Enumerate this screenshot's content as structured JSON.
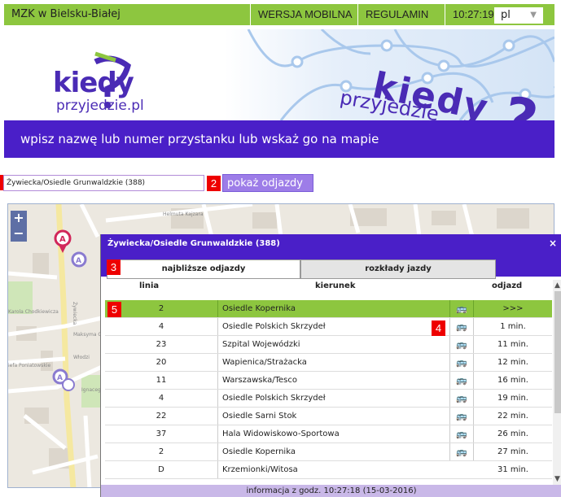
{
  "topbar": {
    "city": "MZK w Bielsku-Białej",
    "mobile_label": "WERSJA MOBILNA",
    "rules_label": "REGULAMIN",
    "time": "10:27:19",
    "lang": "pl"
  },
  "header": {
    "logo_main": "kiedy",
    "logo_sub": "przyjedzie",
    "logo_domain": ".pl",
    "graphic_kiedy": "kiedy",
    "graphic_przy": "przyjedzie",
    "graphic_q": "?"
  },
  "banner": {
    "text": "wpisz nazwę lub numer przystanku lub wskaż go na mapie"
  },
  "search": {
    "badge1": "1",
    "value": "Żywiecka/Osiedle Grunwaldzkie (388)",
    "badge2": "2",
    "show_label": "pokaż odjazdy"
  },
  "map": {
    "zoom_in": "+",
    "zoom_out": "−",
    "streets": [
      "Helmuta Kajzara",
      "Żywiecka",
      "Karola Chodkiewicza",
      "Maksyma G",
      "Włodzi",
      "Ignacego",
      "Grunwaldzka",
      "Ludwika",
      "Pozna"
    ]
  },
  "panel": {
    "title": "Żywiecka/Osiedle Grunwaldzkie (388)",
    "close": "×",
    "badge3": "3",
    "tab_active": "najbliższe odjazdy",
    "tab_inactive": "rozkłady jazdy",
    "col_line": "linia",
    "col_direction": "kierunek",
    "col_departure": "odjazd",
    "badge4": "4",
    "badge5": "5",
    "rows": [
      {
        "line": "2",
        "direction": "Osiedle Kopernika",
        "icon": "🚌",
        "time": ">>>"
      },
      {
        "line": "4",
        "direction": "Osiedle Polskich Skrzydeł",
        "icon": "🚌",
        "time": "1 min."
      },
      {
        "line": "23",
        "direction": "Szpital Wojewódzki",
        "icon": "🚌",
        "time": "11 min."
      },
      {
        "line": "20",
        "direction": "Wapienica/Strażacka",
        "icon": "🚌",
        "time": "12 min."
      },
      {
        "line": "11",
        "direction": "Warszawska/Tesco",
        "icon": "🚌",
        "time": "16 min."
      },
      {
        "line": "4",
        "direction": "Osiedle Polskich Skrzydeł",
        "icon": "🚌",
        "time": "19 min."
      },
      {
        "line": "22",
        "direction": "Osiedle Sarni Stok",
        "icon": "🚌",
        "time": "22 min."
      },
      {
        "line": "37",
        "direction": "Hala Widowiskowo-Sportowa",
        "icon": "🚌",
        "time": "26 min."
      },
      {
        "line": "2",
        "direction": "Osiedle Kopernika",
        "icon": "🚌",
        "time": "27 min."
      },
      {
        "line": "D",
        "direction": "Krzemionki/Witosa",
        "icon": "",
        "time": "31 min."
      }
    ],
    "footer": "informacja z godz. 10:27:18 (15-03-2016)"
  },
  "colors": {
    "green": "#8dc63f",
    "purple": "#4a1fc8",
    "badge_red": "#ee0000"
  }
}
